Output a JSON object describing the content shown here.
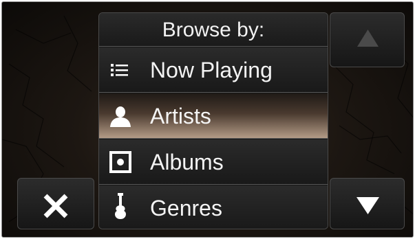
{
  "menu": {
    "title": "Browse by:",
    "items": [
      {
        "label": "Now Playing",
        "icon": "list-icon"
      },
      {
        "label": "Artists",
        "icon": "person-icon",
        "selected": true
      },
      {
        "label": "Albums",
        "icon": "album-icon"
      },
      {
        "label": "Genres",
        "icon": "guitar-icon"
      }
    ]
  },
  "buttons": {
    "close": "close-icon",
    "scroll_up": "triangle-up-icon",
    "scroll_down": "triangle-down-icon"
  },
  "colors": {
    "selected_highlight": "#b39b86",
    "background": "#1d1712",
    "text": "#f4f4f4"
  }
}
